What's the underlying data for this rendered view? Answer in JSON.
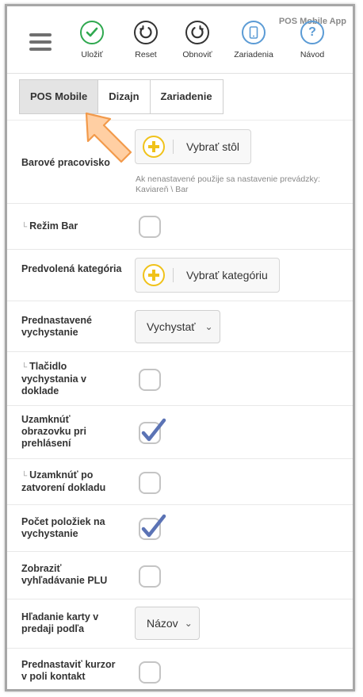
{
  "app_title": "POS Mobile App",
  "toolbar": {
    "buttons": [
      {
        "label": "Uložiť",
        "icon": "check-icon",
        "color": "#2fa84f"
      },
      {
        "label": "Reset",
        "icon": "refresh-icon",
        "color": "#333333"
      },
      {
        "label": "Obnoviť",
        "icon": "refresh-icon",
        "color": "#333333"
      },
      {
        "label": "Zariadenia",
        "icon": "mobile-device-icon",
        "color": "#5b9bd5"
      },
      {
        "label": "Návod",
        "icon": "question-icon",
        "color": "#5b9bd5"
      }
    ]
  },
  "tabs": [
    "POS Mobile",
    "Dizajn",
    "Zariadenie"
  ],
  "active_tab": "POS Mobile",
  "rows": {
    "bar_workplace": {
      "label": "Barové pracovisko",
      "button": "Vybrať stôl",
      "hint": "Ak nenastavené použije sa nastavenie prevádzky: Kaviareň \\ Bar"
    },
    "bar_mode": {
      "label": "Režim Bar",
      "checked": false
    },
    "default_category": {
      "label": "Predvolená kategória",
      "button": "Vybrať kategóriu"
    },
    "default_prepare": {
      "label": "Prednastavené vychystanie",
      "value": "Vychystať"
    },
    "prepare_button": {
      "label": "Tlačidlo vychystania v doklade",
      "checked": false
    },
    "lock_on_login": {
      "label": "Uzamknúť obrazovku pri prehlásení",
      "checked": true
    },
    "lock_after_close": {
      "label": "Uzamknúť po zatvorení dokladu",
      "checked": false
    },
    "count_items": {
      "label": "Počet položiek na vychystanie",
      "checked": true
    },
    "plu_search": {
      "label": "Zobraziť vyhľadávanie PLU",
      "checked": false
    },
    "card_search": {
      "label": "Hľadanie karty v predaji podľa",
      "value": "Názov"
    },
    "cursor_contact": {
      "label": "Prednastaviť kurzor v poli kontakt",
      "checked": false
    }
  },
  "colors": {
    "accent_check": "#5b73b5",
    "plus_yellow": "#f0c21a",
    "arrow_fill": "#ffcfa3",
    "arrow_stroke": "#f29a4b"
  }
}
